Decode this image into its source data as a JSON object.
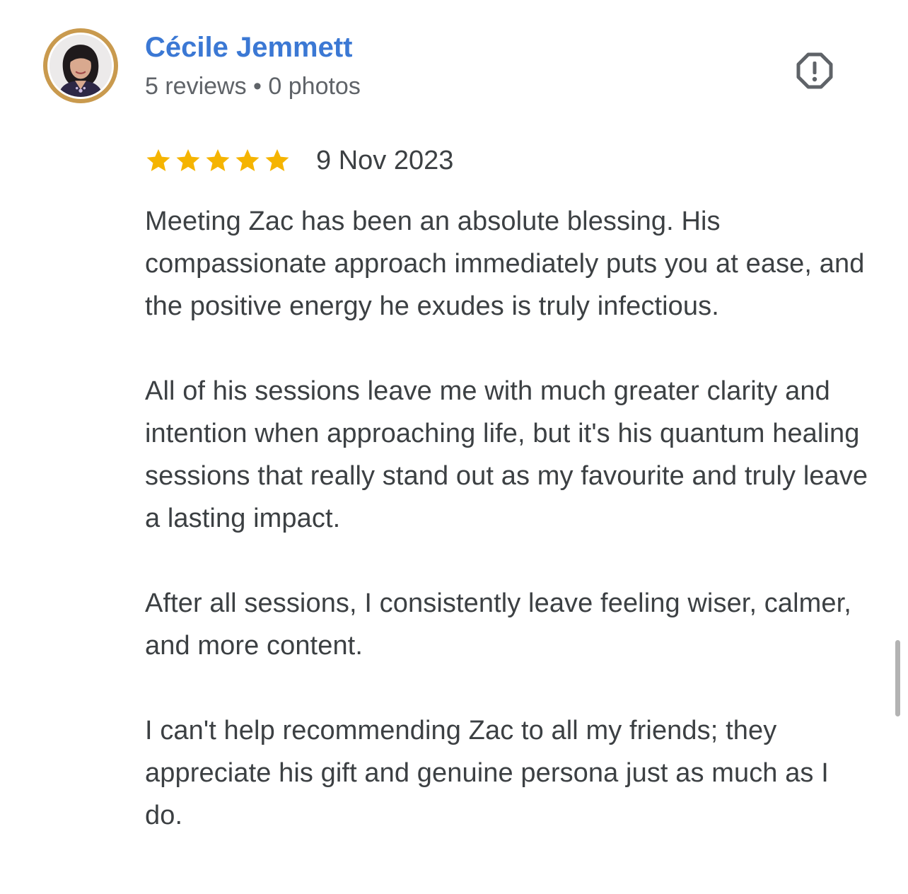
{
  "review": {
    "author": {
      "name": "Cécile Jemmett",
      "meta": "5 reviews • 0 photos",
      "avatar_icon": "profile-photo"
    },
    "report_icon": "report-flag-icon",
    "rating": {
      "stars": 5,
      "max_stars": 5,
      "star_color": "#f5b400",
      "date": "9 Nov 2023"
    },
    "paragraphs": [
      "Meeting Zac has been an absolute blessing. His compassionate approach immediately puts you at ease, and the positive energy he exudes is truly infectious.",
      "All of his sessions leave me with much greater clarity and intention when approaching life, but it's his quantum healing sessions that really stand out as my favourite and truly leave a lasting impact.",
      "After all sessions, I consistently leave feeling wiser, calmer, and more content.",
      "I can't help recommending Zac to all my friends; they appreciate his gift and genuine persona just as much as I do."
    ]
  },
  "colors": {
    "author_name": "#3b78d4",
    "meta_text": "#5f6368",
    "body_text": "#3c4043",
    "avatar_ring": "#c99a4e",
    "icon_gray": "#5f6368"
  }
}
